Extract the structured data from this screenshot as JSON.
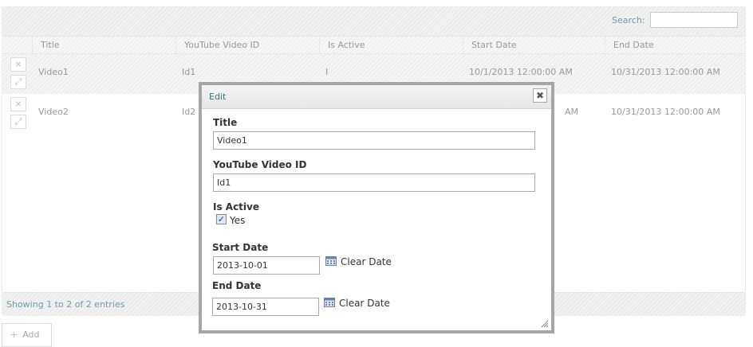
{
  "search": {
    "label": "Search:",
    "value": ""
  },
  "table": {
    "columns": [
      "Title",
      "YouTube Video ID",
      "Is Active",
      "Start Date",
      "End Date"
    ],
    "rows": [
      {
        "title": "Video1",
        "video_id": "Id1",
        "active": "I",
        "start": "10/1/2013 12:00:00 AM",
        "end": "10/31/2013 12:00:00 AM"
      },
      {
        "title": "Video2",
        "video_id": "Id2",
        "active": "",
        "start": "AM",
        "end": "10/31/2013 12:00:00 AM"
      }
    ],
    "row_delete_glyph": "×",
    "row_edit_glyph": "⤢"
  },
  "footer": {
    "info": "Showing 1 to 2 of 2 entries"
  },
  "add_button": {
    "label": "Add",
    "glyph": "+"
  },
  "dialog": {
    "title": "Edit",
    "close_glyph": "✖",
    "fields": {
      "title": {
        "label": "Title",
        "value": "Video1"
      },
      "video_id": {
        "label": "YouTube Video ID",
        "value": "Id1"
      },
      "is_active": {
        "label": "Is Active",
        "checkbox_label": "Yes",
        "checked": true
      },
      "start_date": {
        "label": "Start Date",
        "value": "2013-10-01",
        "clear": "Clear Date"
      },
      "end_date": {
        "label": "End Date",
        "value": "2013-10-31",
        "clear": "Clear Date"
      }
    }
  },
  "icons": {
    "calendar": "calendar-icon",
    "close": "close-icon",
    "resize": "resize-grip-icon"
  },
  "colors": {
    "accent": "#2d7a86",
    "link": "#6b9bb3",
    "dialog_border": "#a6a6a6"
  }
}
